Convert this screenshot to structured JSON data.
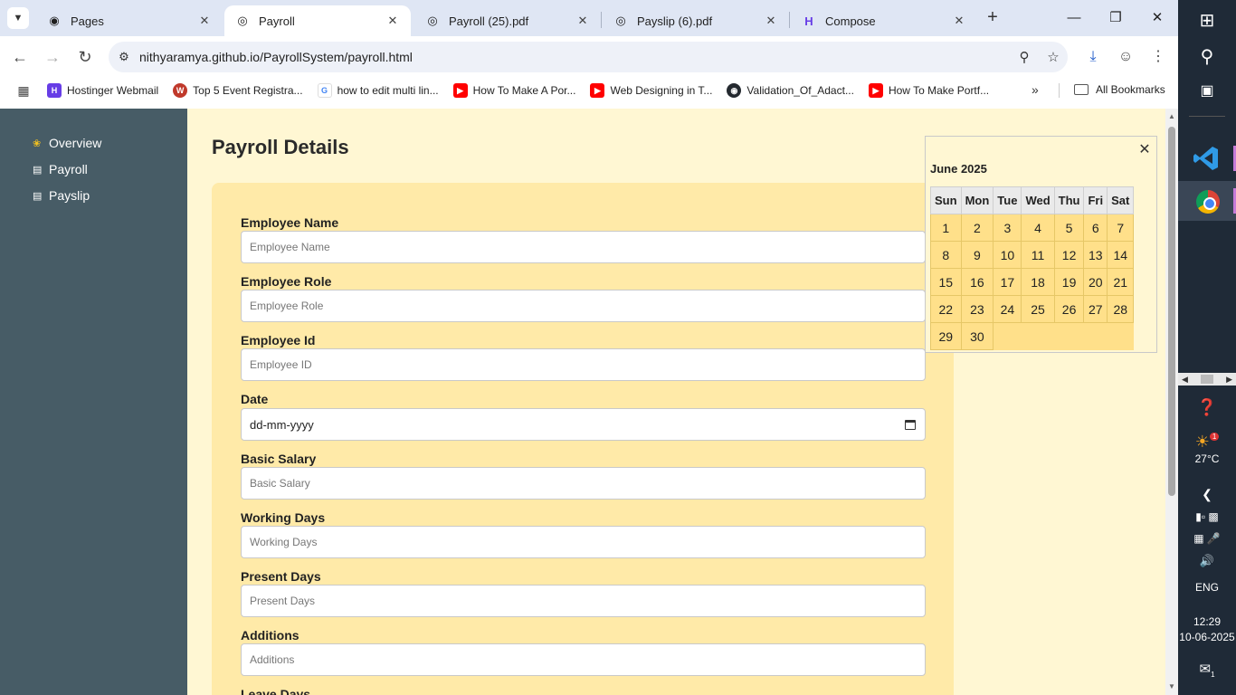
{
  "browser": {
    "tabs": [
      {
        "title": "Pages",
        "favicon": "github-icon",
        "active": false
      },
      {
        "title": "Payroll",
        "favicon": "globe-icon",
        "active": true
      },
      {
        "title": "Payroll (25).pdf",
        "favicon": "globe-icon",
        "active": false
      },
      {
        "title": "Payslip (6).pdf",
        "favicon": "globe-icon",
        "active": false
      },
      {
        "title": "Compose",
        "favicon": "hostinger-icon",
        "active": false
      }
    ],
    "url": "nithyaramya.github.io/PayrollSystem/payroll.html",
    "bookmarks": [
      {
        "label": "Hostinger Webmail",
        "icon": "hostinger-icon",
        "color": "#673de6"
      },
      {
        "label": "Top 5 Event Registra...",
        "icon": "w-icon",
        "color": "#c0392b"
      },
      {
        "label": "how to edit multi lin...",
        "icon": "google-icon",
        "color": "#4285f4"
      },
      {
        "label": "How To Make A Por...",
        "icon": "youtube-icon",
        "color": "#ff0000"
      },
      {
        "label": "Web Designing in T...",
        "icon": "youtube-icon",
        "color": "#ff0000"
      },
      {
        "label": "Validation_Of_Adact...",
        "icon": "github-icon",
        "color": "#24292f"
      },
      {
        "label": "How To Make Portf...",
        "icon": "youtube-icon",
        "color": "#ff0000"
      }
    ],
    "all_bookmarks": "All Bookmarks"
  },
  "sidebar": {
    "items": [
      {
        "label": "Overview",
        "icon": "palette-icon"
      },
      {
        "label": "Payroll",
        "icon": "receipt-icon"
      },
      {
        "label": "Payslip",
        "icon": "receipt-icon"
      }
    ]
  },
  "main": {
    "title": "Payroll Details",
    "fields": [
      {
        "label": "Employee Name",
        "placeholder": "Employee Name"
      },
      {
        "label": "Employee Role",
        "placeholder": "Employee Role"
      },
      {
        "label": "Employee Id",
        "placeholder": "Employee ID"
      },
      {
        "label": "Date",
        "placeholder": "dd-mm-yyyy"
      },
      {
        "label": "Basic Salary",
        "placeholder": "Basic Salary"
      },
      {
        "label": "Working Days",
        "placeholder": "Working Days"
      },
      {
        "label": "Present Days",
        "placeholder": "Present Days"
      },
      {
        "label": "Additions",
        "placeholder": "Additions"
      },
      {
        "label": "Leave Days",
        "placeholder": ""
      }
    ]
  },
  "calendar": {
    "month": "June 2025",
    "weekdays": [
      "Sun",
      "Mon",
      "Tue",
      "Wed",
      "Thu",
      "Fri",
      "Sat"
    ],
    "weeks": [
      [
        "1",
        "2",
        "3",
        "4",
        "5",
        "6",
        "7"
      ],
      [
        "8",
        "9",
        "10",
        "11",
        "12",
        "13",
        "14"
      ],
      [
        "15",
        "16",
        "17",
        "18",
        "19",
        "20",
        "21"
      ],
      [
        "22",
        "23",
        "24",
        "25",
        "26",
        "27",
        "28"
      ],
      [
        "29",
        "30",
        "",
        "",
        "",
        "",
        ""
      ]
    ]
  },
  "taskbar": {
    "weather": "27°C",
    "weather_badge": "1",
    "language": "ENG",
    "time": "12:29",
    "date": "10-06-2025",
    "notification_count": "1"
  },
  "colors": {
    "sidebar_bg": "#475c66",
    "page_bg": "#fff7d3",
    "card_bg": "#ffeaa8",
    "calendar_day_bg": "#ffe08a"
  }
}
